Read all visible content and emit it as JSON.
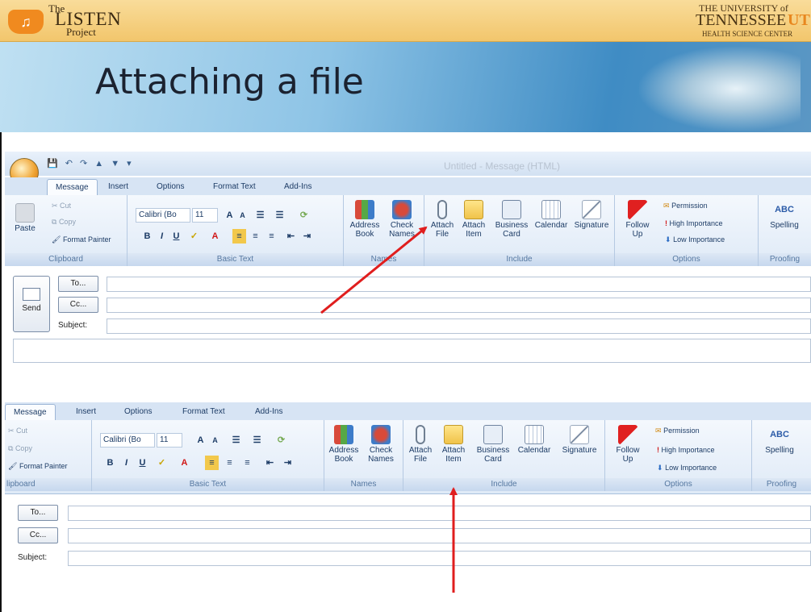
{
  "header": {
    "logo_the": "The",
    "logo_main": "LISTEN",
    "logo_sub": "Project",
    "uni_line1": "THE UNIVERSITY of",
    "uni_line2": "TENNESSEE",
    "uni_ut": "UT",
    "uni_line3": "HEALTH SCIENCE CENTER",
    "accent": "#f2c66c"
  },
  "slide": {
    "title": "Attaching a file"
  },
  "window1": {
    "title": "Untitled - Message (HTML)",
    "tabs": [
      "Message",
      "Insert",
      "Options",
      "Format Text",
      "Add-Ins"
    ],
    "clipboard": {
      "paste": "Paste",
      "cut": "Cut",
      "copy": "Copy",
      "format_painter": "Format Painter",
      "label": "Clipboard"
    },
    "basic_text": {
      "font": "Calibri (Bo",
      "size": "11",
      "label": "Basic Text"
    },
    "names": {
      "address_book": "Address Book",
      "check_names": "Check Names",
      "label": "Names"
    },
    "include": {
      "attach_file": "Attach File",
      "attach_item": "Attach Item",
      "business_card": "Business Card",
      "calendar": "Calendar",
      "signature": "Signature",
      "label": "Include"
    },
    "options": {
      "follow_up": "Follow Up",
      "permission": "Permission",
      "high_importance": "High Importance",
      "low_importance": "Low Importance",
      "label": "Options"
    },
    "proofing": {
      "spelling": "Spelling",
      "label": "Proofing"
    },
    "send": "Send",
    "to": "To...",
    "cc": "Cc...",
    "subject": "Subject:"
  },
  "window2": {
    "tabs": [
      "Message",
      "Insert",
      "Options",
      "Format Text",
      "Add-Ins"
    ],
    "clipboard": {
      "cut": "Cut",
      "copy": "Copy",
      "format_painter": "Format Painter",
      "label": "lipboard"
    },
    "basic_text": {
      "font": "Calibri (Bo",
      "size": "11",
      "label": "Basic Text"
    },
    "names": {
      "address_book": "Address Book",
      "check_names": "Check Names",
      "label": "Names"
    },
    "include": {
      "attach_file": "Attach File",
      "attach_item": "Attach Item",
      "business_card": "Business Card",
      "calendar": "Calendar",
      "signature": "Signature",
      "label": "Include"
    },
    "options": {
      "follow_up": "Follow Up",
      "permission": "Permission",
      "high_importance": "High Importance",
      "low_importance": "Low Importance",
      "label": "Options"
    },
    "proofing": {
      "spelling": "Spelling",
      "label": "Proofing"
    },
    "to": "To...",
    "cc": "Cc...",
    "subject": "Subject:"
  },
  "arrow_color": "#e01e1e"
}
